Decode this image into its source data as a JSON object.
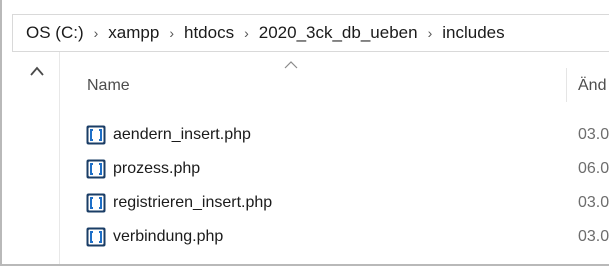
{
  "breadcrumb": {
    "items": [
      "OS (C:)",
      "xampp",
      "htdocs",
      "2020_3ck_db_ueben",
      "includes"
    ],
    "separator": "›"
  },
  "columns": {
    "name": "Name",
    "date": "Änd"
  },
  "files": [
    {
      "name": "aendern_insert.php",
      "date": "03.0"
    },
    {
      "name": "prozess.php",
      "date": "06.0"
    },
    {
      "name": "registrieren_insert.php",
      "date": "03.0"
    },
    {
      "name": "verbindung.php",
      "date": "03.0"
    }
  ],
  "icons": {
    "file": "php-file-icon",
    "up": "chevron-up-icon",
    "sort": "sort-ascending-icon"
  },
  "colors": {
    "file_icon_blue": "#1e6fc7",
    "file_icon_bg": "#1a3d66"
  }
}
